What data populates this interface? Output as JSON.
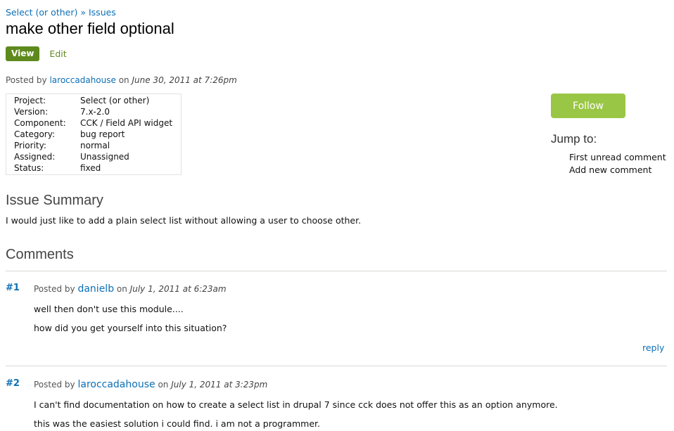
{
  "breadcrumb": {
    "project": "Select (or other)",
    "separator": "»",
    "issues": "Issues"
  },
  "page_title": "make other field optional",
  "tabs": {
    "view": "View",
    "edit": "Edit"
  },
  "posted": {
    "prefix": "Posted by",
    "author": "laroccadahouse",
    "on": "on",
    "date": "June 30, 2011 at 7:26pm"
  },
  "meta": [
    {
      "key": "Project:",
      "value": "Select (or other)"
    },
    {
      "key": "Version:",
      "value": "7.x-2.0"
    },
    {
      "key": "Component:",
      "value": "CCK / Field API widget"
    },
    {
      "key": "Category:",
      "value": "bug report"
    },
    {
      "key": "Priority:",
      "value": "normal"
    },
    {
      "key": "Assigned:",
      "value": "Unassigned"
    },
    {
      "key": "Status:",
      "value": "fixed"
    }
  ],
  "sidebar": {
    "follow_label": "Follow",
    "jump_title": "Jump to:",
    "jump_links": [
      "First unread comment",
      "Add new comment"
    ]
  },
  "summary": {
    "heading": "Issue Summary",
    "text": "I would just like to add a plain select list without allowing a user to choose other."
  },
  "comments_heading": "Comments",
  "comments": [
    {
      "number": "#1",
      "prefix": "Posted by",
      "author": "danielb",
      "on": "on",
      "date": "July 1, 2011 at 6:23am",
      "lines": [
        "well then don't use this module....",
        "how did you get yourself into this situation?"
      ],
      "reply": "reply"
    },
    {
      "number": "#2",
      "prefix": "Posted by",
      "author": "laroccadahouse",
      "on": "on",
      "date": "July 1, 2011 at 3:23pm",
      "lines": [
        "I can't find documentation on how to create a select list in drupal 7 since cck does not offer this as an option anymore.",
        "this was the easiest solution i could find. i am not a programmer."
      ]
    }
  ],
  "colors": {
    "link": "#0d6fb5",
    "tab_active": "#5e8a1d",
    "follow": "#9ac645"
  }
}
